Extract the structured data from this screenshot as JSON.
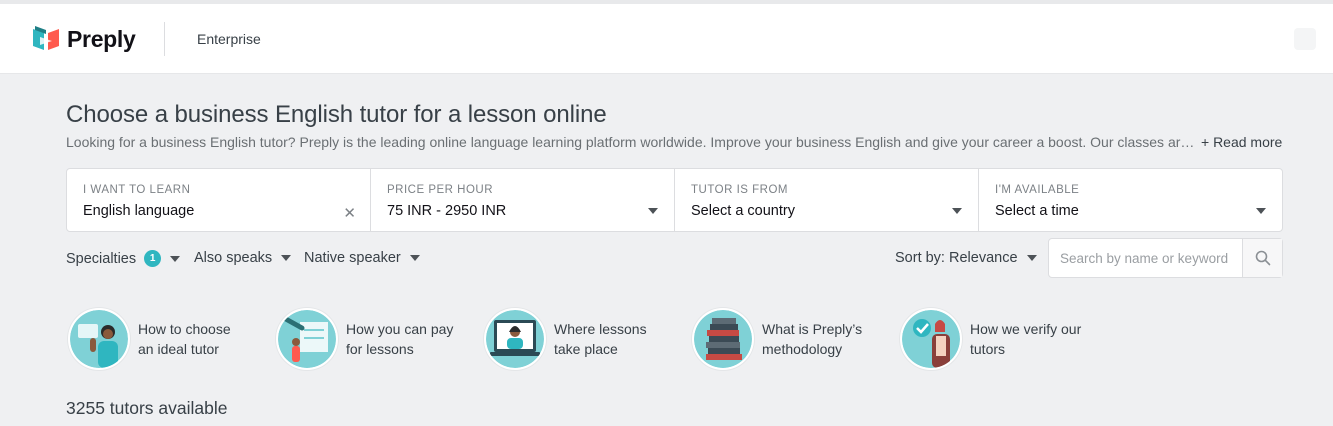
{
  "header": {
    "brand": "Preply",
    "nav_enterprise": "Enterprise"
  },
  "page": {
    "title": "Choose a business English tutor for a lesson online",
    "subtitle": "Looking for a business English tutor? Preply is the leading online language learning platform worldwide. Improve your business English and give your career a boost. Our classes ar…",
    "read_more": "+ Read more"
  },
  "filters": [
    {
      "label": "I WANT TO LEARN",
      "value": "English language",
      "icon": "clear-icon"
    },
    {
      "label": "PRICE PER HOUR",
      "value": "75 INR - 2950 INR",
      "icon": "chevron-down-icon"
    },
    {
      "label": "TUTOR IS FROM",
      "value": "Select a country",
      "icon": "chevron-down-icon"
    },
    {
      "label": "I'M AVAILABLE",
      "value": "Select a time",
      "icon": "chevron-down-icon"
    }
  ],
  "chips": {
    "specialties": "Specialties",
    "specialties_count": "1",
    "also_speaks": "Also speaks",
    "native_speaker": "Native speaker",
    "sort_by": "Sort by: Relevance"
  },
  "search": {
    "placeholder": "Search by name or keyword",
    "value": ""
  },
  "guides": [
    {
      "line1": "How to choose",
      "line2": "an ideal tutor"
    },
    {
      "line1": "How you can pay",
      "line2": "for lessons"
    },
    {
      "line1": "Where lessons",
      "line2": "take place"
    },
    {
      "line1": "What is Preply’s",
      "line2": "methodology"
    },
    {
      "line1": "How we verify our",
      "line2": "tutors"
    }
  ],
  "results": {
    "count_text": "3255 tutors available"
  },
  "colors": {
    "accent": "#2fb6c0",
    "brand_red": "#ff5a4e",
    "illustration_teal": "#7fd1d6",
    "background": "#eff0f2"
  }
}
